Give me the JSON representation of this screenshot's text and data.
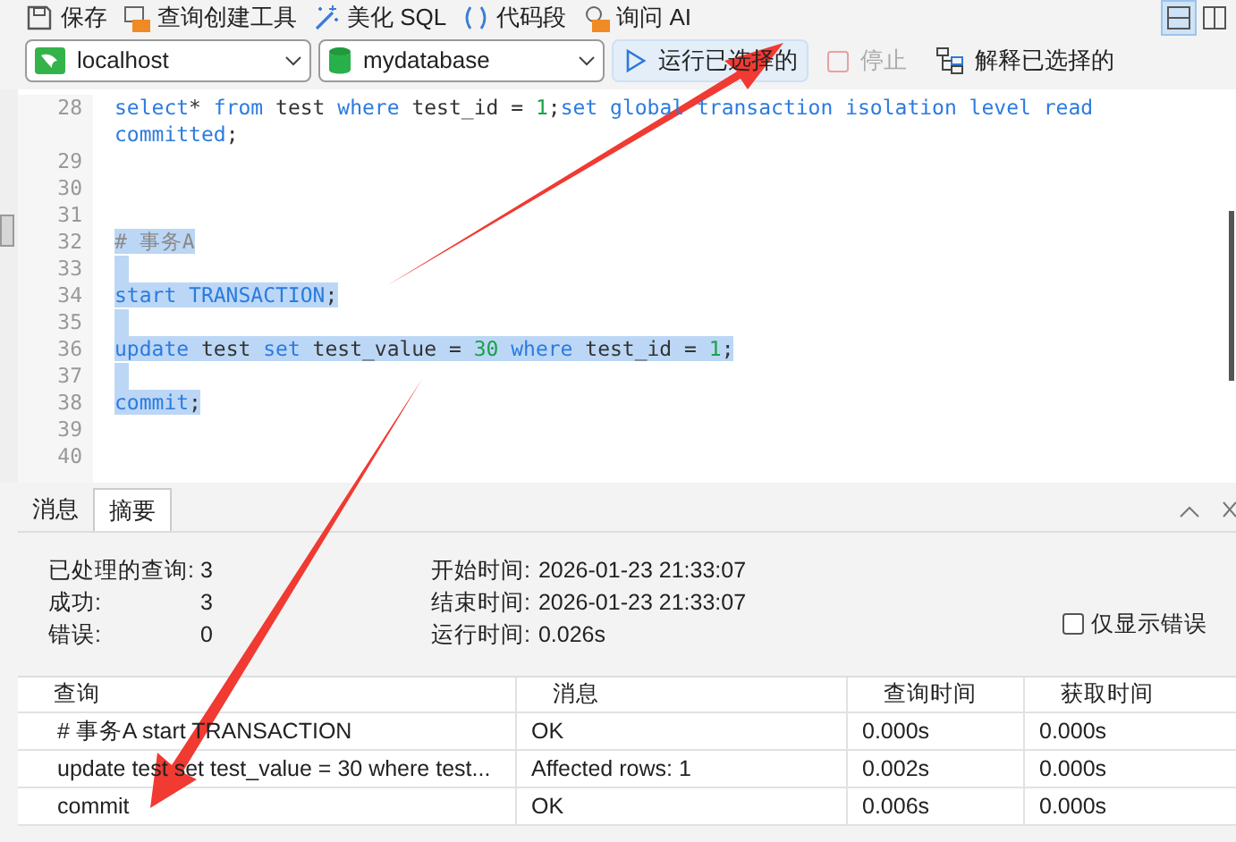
{
  "toolbar": [
    {
      "label": "保存"
    },
    {
      "label": "查询创建工具"
    },
    {
      "label": "美化 SQL"
    },
    {
      "label": "代码段"
    },
    {
      "label": "询问 AI"
    }
  ],
  "layout_toggles": [
    {
      "selected": true
    },
    {
      "selected": false
    }
  ],
  "connection": {
    "value": "localhost"
  },
  "database": {
    "value": "mydatabase"
  },
  "actions": [
    {
      "label": "运行已选择的",
      "disabled": false,
      "highlighted": true
    },
    {
      "label": "停止",
      "disabled": true,
      "highlighted": false
    },
    {
      "label": "解释已选择的",
      "disabled": false,
      "highlighted": false
    }
  ],
  "editor": {
    "lines": [
      {
        "number": "28",
        "selected": false,
        "tokens": [
          {
            "kind": "keyword",
            "text": "select"
          },
          {
            "kind": "plain",
            "text": "* "
          },
          {
            "kind": "keyword",
            "text": "from"
          },
          {
            "kind": "plain",
            "text": " test "
          },
          {
            "kind": "keyword",
            "text": "where"
          },
          {
            "kind": "plain",
            "text": " test_id = "
          },
          {
            "kind": "number",
            "text": "1"
          },
          {
            "kind": "plain",
            "text": ";"
          },
          {
            "kind": "keyword",
            "text": "set global transaction isolation level read committed"
          },
          {
            "kind": "plain",
            "text": ";"
          }
        ]
      },
      {
        "number": "29",
        "selected": false
      },
      {
        "number": "30",
        "selected": false
      },
      {
        "number": "31",
        "selected": false
      },
      {
        "number": "32",
        "selected": true,
        "tokens": [
          {
            "kind": "comment",
            "text": "# 事务A"
          }
        ]
      },
      {
        "number": "33",
        "selected": true
      },
      {
        "number": "34",
        "selected": true,
        "tokens": [
          {
            "kind": "keyword",
            "text": "start TRANSACTION"
          },
          {
            "kind": "plain",
            "text": ";"
          }
        ]
      },
      {
        "number": "35",
        "selected": true
      },
      {
        "number": "36",
        "selected": true,
        "tokens": [
          {
            "kind": "keyword",
            "text": "update"
          },
          {
            "kind": "plain",
            "text": " test "
          },
          {
            "kind": "keyword",
            "text": "set"
          },
          {
            "kind": "plain",
            "text": " test_value = "
          },
          {
            "kind": "number",
            "text": "30"
          },
          {
            "kind": "keyword",
            "text": " where"
          },
          {
            "kind": "plain",
            "text": " test_id = "
          },
          {
            "kind": "number",
            "text": "1"
          },
          {
            "kind": "plain",
            "text": ";"
          }
        ]
      },
      {
        "number": "37",
        "selected": true
      },
      {
        "number": "38",
        "selected": true,
        "tokens": [
          {
            "kind": "keyword",
            "text": "commit"
          },
          {
            "kind": "plain",
            "text": ";"
          }
        ]
      },
      {
        "number": "39",
        "selected": false
      },
      {
        "number": "40",
        "selected": false
      }
    ]
  },
  "result_tabs": [
    {
      "label": "消息",
      "selected": false
    },
    {
      "label": "摘要",
      "selected": true
    }
  ],
  "summary": {
    "left": [
      {
        "label": "已处理的查询:",
        "value": "3"
      },
      {
        "label": "成功:",
        "value": "3"
      },
      {
        "label": "错误:",
        "value": "0"
      }
    ],
    "right": [
      {
        "label": "开始时间:",
        "value": "2026-01-23 21:33:07"
      },
      {
        "label": "结束时间:",
        "value": "2026-01-23 21:33:07"
      },
      {
        "label": "运行时间:",
        "value": "0.026s"
      }
    ],
    "errors_only": {
      "label": "仅显示错误",
      "checked": false
    }
  },
  "table": {
    "columns": [
      "查询",
      "消息",
      "查询时间",
      "获取时间"
    ],
    "rows": [
      [
        "# 事务A start TRANSACTION",
        "OK",
        "0.000s",
        "0.000s"
      ],
      [
        "update test set test_value = 30 where test...",
        "Affected rows: 1",
        "0.002s",
        "0.000s"
      ],
      [
        "commit",
        "OK",
        "0.006s",
        "0.000s"
      ]
    ]
  }
}
